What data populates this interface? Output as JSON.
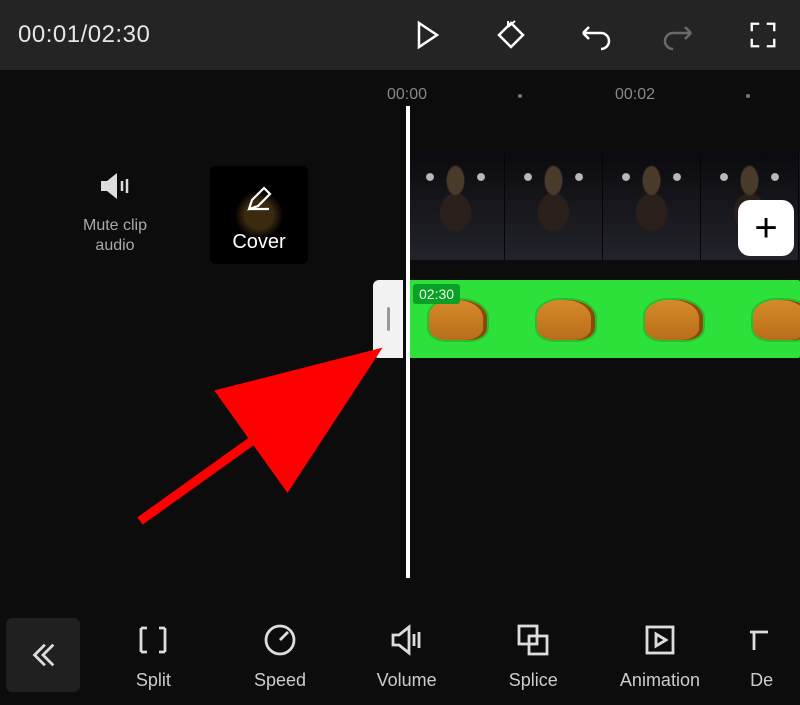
{
  "header": {
    "current_time": "00:01",
    "total_time": "02:30"
  },
  "ruler": {
    "t0": "00:00",
    "t1": "00:02"
  },
  "controls": {
    "mute_label_line1": "Mute clip",
    "mute_label_line2": "audio",
    "cover_label": "Cover"
  },
  "tracks": {
    "clip2_duration": "02:30",
    "add_label": "+"
  },
  "toolbar": {
    "split": "Split",
    "speed": "Speed",
    "volume": "Volume",
    "splice": "Splice",
    "animation": "Animation",
    "delete": "De"
  }
}
